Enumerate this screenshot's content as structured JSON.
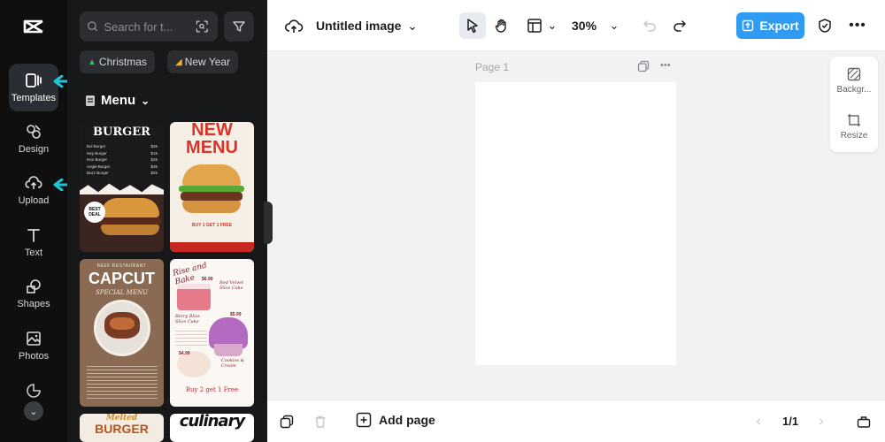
{
  "rail": {
    "items": [
      {
        "label": "Templates",
        "icon": "templates-icon"
      },
      {
        "label": "Design",
        "icon": "design-icon"
      },
      {
        "label": "Upload",
        "icon": "upload-icon"
      },
      {
        "label": "Text",
        "icon": "text-icon"
      },
      {
        "label": "Shapes",
        "icon": "shapes-icon"
      },
      {
        "label": "Photos",
        "icon": "photos-icon"
      }
    ],
    "active": "Templates",
    "arrow_color": "#1bc6d8"
  },
  "panel": {
    "search_placeholder": "Search for t...",
    "chips": [
      {
        "label": "Christmas",
        "icon": "christmas-tree-icon"
      },
      {
        "label": "New Year",
        "icon": "party-popper-icon"
      }
    ],
    "category": "Menu",
    "templates": {
      "t1": {
        "title": "BURGER",
        "items": [
          "Bol Burger",
          "Hey Burger",
          "Hoo Burger",
          "Angel Burger",
          "Buzz Burger"
        ],
        "prices": [
          "$35",
          "$15",
          "$25",
          "$35",
          "$25"
        ],
        "badge_line1": "BEST",
        "badge_line2": "DEAL"
      },
      "t2": {
        "title_line1": "NEW",
        "title_line2": "MENU",
        "footer": "BUY 1 GET 1 FREE"
      },
      "t3": {
        "kicker": "BEEF RESTAURANT",
        "title": "CAPCUT",
        "subtitle": "SPECIAL MENU"
      },
      "t4": {
        "title": "Rise and Bake",
        "items": [
          "Red Velvet Slice Cake",
          "Berry Bliss Slice Cake",
          "Cookies & Cream"
        ],
        "prices": [
          "$6.99",
          "$5.99",
          "$4.99"
        ],
        "footer": "Buy 2 get 1 Free"
      },
      "t5": {
        "title_line1": "Melted",
        "title_line2": "BURGER"
      },
      "t6": {
        "title": "culinary"
      }
    }
  },
  "topbar": {
    "title": "Untitled image",
    "zoom": "30%",
    "export_label": "Export",
    "export_color": "#2f9bf3"
  },
  "canvas": {
    "page_label": "Page 1"
  },
  "side_tools": {
    "background": "Backgr...",
    "resize": "Resize"
  },
  "bottombar": {
    "add_page": "Add page",
    "page_count": "1/1"
  }
}
